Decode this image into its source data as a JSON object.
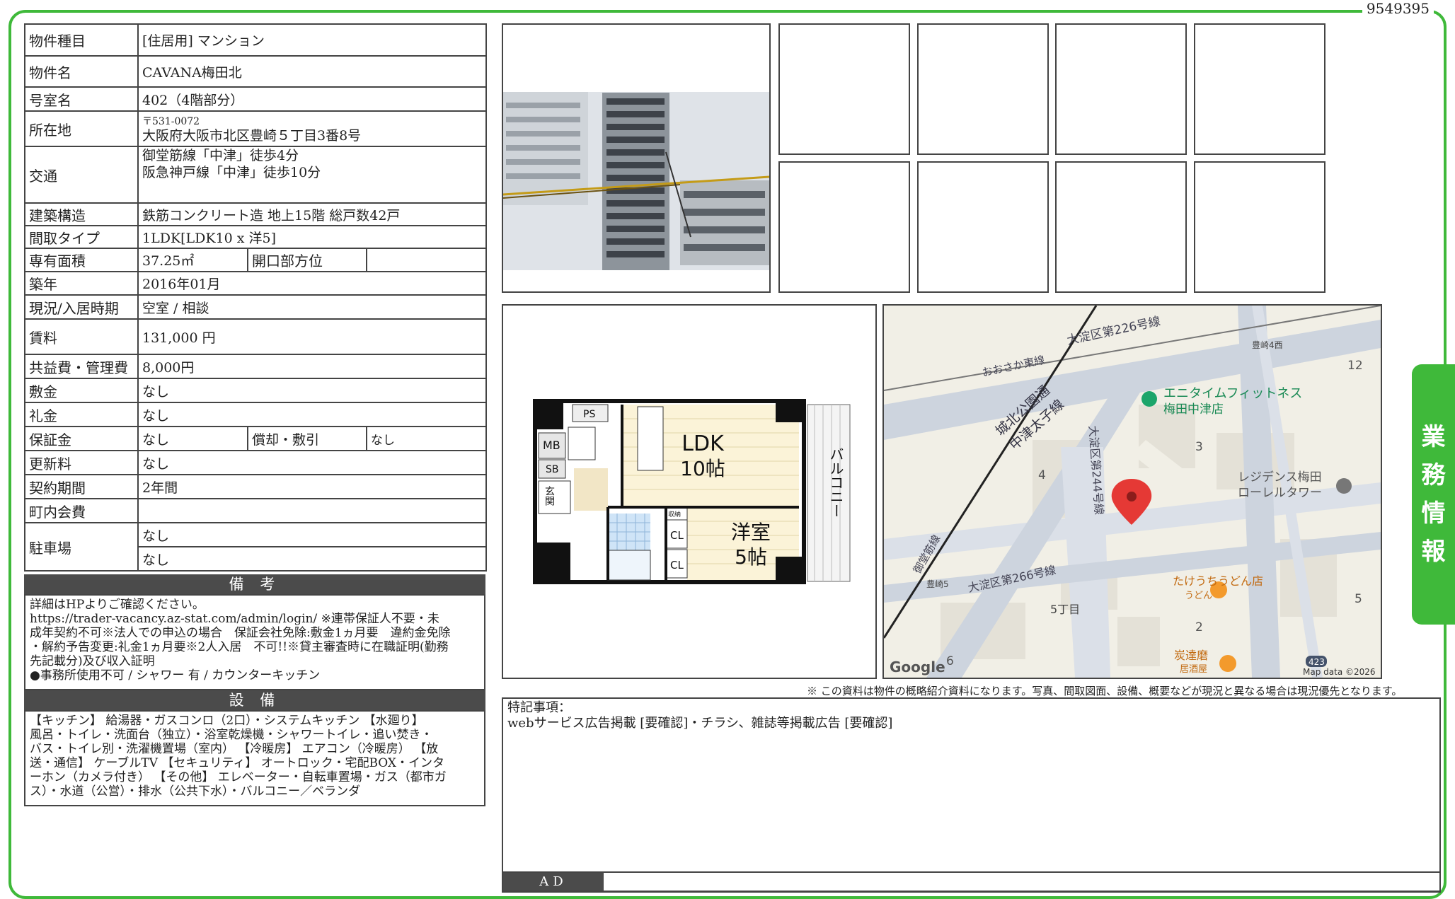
{
  "doc_id": "9549395",
  "side_tab": [
    "業",
    "務",
    "情",
    "報"
  ],
  "property": {
    "type_label": "物件種目",
    "type_value": "[住居用] マンション",
    "name_label": "物件名",
    "name_value": "CAVANA梅田北",
    "room_label": "号室名",
    "room_value": "402（4階部分）",
    "address_label": "所在地",
    "zip": "〒531-0072",
    "address": "大阪府大阪市北区豊崎５丁目3番8号",
    "transit_label": "交通",
    "transit_1": "御堂筋線「中津」徒歩4分",
    "transit_2": "阪急神戸線「中津」徒歩10分",
    "structure_label": "建築構造",
    "structure_value": "鉄筋コンクリート造 地上15階 総戸数42戸",
    "layout_label": "間取タイプ",
    "layout_value": "1LDK[LDK10 x 洋5]",
    "area_label": "専有面積",
    "area_value": "37.25㎡",
    "direction_label": "開口部方位",
    "direction_value": "",
    "built_label": "築年",
    "built_value": "2016年01月",
    "status_label": "現況/入居時期",
    "status_value": "空室 / 相談",
    "rent_label": "賃料",
    "rent_value": "131,000 円",
    "fee_label": "共益費・管理費",
    "fee_value": "8,000円",
    "deposit_label": "敷金",
    "deposit_value": "なし",
    "keymoney_label": "礼金",
    "keymoney_value": "なし",
    "guarantee_label": "保証金",
    "guarantee_value": "なし",
    "amort_label": "償却・敷引",
    "amort_value": "なし",
    "renewal_label": "更新料",
    "renewal_value": "なし",
    "contract_label": "契約期間",
    "contract_value": "2年間",
    "community_label": "町内会費",
    "community_value": "",
    "parking_label": "駐車場",
    "parking_1": "なし",
    "parking_2": "なし"
  },
  "notes": {
    "title": "備 考",
    "lines": [
      "詳細はHPよりご確認ください。",
      "https://trader-vacancy.az-stat.com/admin/login/ ※連帯保証人不要・未",
      "成年契約不可※法人での申込の場合　保証会社免除:敷金1ヵ月要　違約金免除",
      "・解約予告変更:礼金1ヵ月要※2人入居　不可!!※貸主審査時に在職証明(勤務",
      "先記載分)及び収入証明",
      "●事務所使用不可 / シャワー 有 / カウンターキッチン"
    ]
  },
  "equipment": {
    "title": "設 備",
    "lines": [
      "【キッチン】 給湯器・ガスコンロ（2口）・システムキッチン 【水廻り】",
      "風呂・トイレ・洗面台（独立）・浴室乾燥機・シャワートイレ・追い焚き・",
      "バス・トイレ別・洗濯機置場（室内） 【冷暖房】 エアコン（冷暖房） 【放",
      "送・通信】 ケーブルTV 【セキュリティ】 オートロック・宅配BOX・インタ",
      "ーホン（カメラ付き） 【その他】 エレベーター・自転車置場・ガス（都市ガ",
      "ス）・水道（公営）・排水（公共下水）・バルコニー／ベランダ"
    ]
  },
  "floorplan": {
    "ldk": "LDK",
    "ldk_size": "10帖",
    "western": "洋室",
    "western_size": "5帖",
    "balcony": "バルコニー",
    "ps": "PS",
    "mb": "MB",
    "sb": "SB",
    "entrance": "玄関",
    "storage": "収納",
    "cl1": "CL",
    "cl2": "CL"
  },
  "map": {
    "road1": "大淀区第226号線",
    "line1": "おおさか東線",
    "road2": "城北公園通",
    "road3": "中津太子線",
    "road4": "大淀区第244号線",
    "road5": "大淀区第266号線",
    "road6": "御堂筋線",
    "poi1_a": "エニタイムフィットネス",
    "poi1_b": "梅田中津店",
    "poi2_a": "レジデンス梅田",
    "poi2_b": "ローレルタワー",
    "poi3_a": "たけうちうどん店",
    "poi3_b": "うどん",
    "poi4_a": "炭達磨",
    "poi4_b": "居酒屋",
    "area1": "豊崎4西",
    "area2": "豊崎5",
    "area3": "5丁目",
    "n12": "12",
    "n3": "3",
    "n4": "4",
    "n5": "5",
    "n2": "2",
    "n6": "6",
    "route": "423",
    "google": "Google",
    "credit": "Map data ©2026"
  },
  "disclaimer": "※ この資料は物件の概略紹介資料になります。写真、間取図面、設備、概要などが現況と異なる場合は現況優先となります。",
  "remarks": {
    "title": "特記事項：",
    "text": "webサービス広告掲載 [要確認]・チラシ、雑誌等掲載広告 [要確認]"
  },
  "ad_label": "AD"
}
